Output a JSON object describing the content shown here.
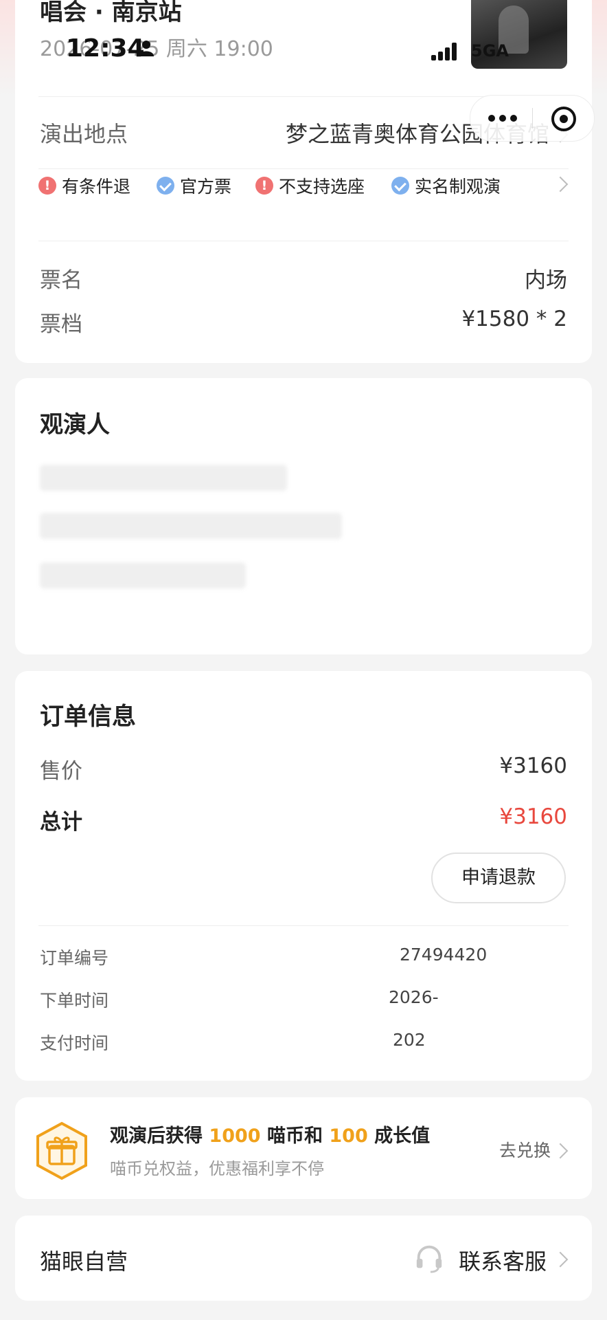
{
  "status_bar": {
    "time": "12:34",
    "network": "5GA"
  },
  "event": {
    "title_fragment": "唱会 · 南京站",
    "datetime": "2026-07-25 周六 19:00"
  },
  "venue": {
    "label": "演出地点",
    "value": "梦之蓝青奥体育公园体育馆"
  },
  "tags": [
    {
      "icon": "warning-icon",
      "label": "有条件退"
    },
    {
      "icon": "check-badge-icon",
      "label": "官方票"
    },
    {
      "icon": "warning-icon",
      "label": "不支持选座"
    },
    {
      "icon": "check-badge-icon",
      "label": "实名制观演"
    }
  ],
  "ticket": {
    "name_label": "票名",
    "name_value": "内场",
    "tier_label": "票档",
    "tier_value": "¥1580 * 2"
  },
  "attendee": {
    "title": "观演人"
  },
  "order": {
    "title": "订单信息",
    "price_label": "售价",
    "price_value": "¥3160",
    "total_label": "总计",
    "total_value": "¥3160",
    "refund_button": "申请退款",
    "order_no_label": "订单编号",
    "order_no_value": "27494420",
    "order_time_label": "下单时间",
    "order_time_value": "2026-",
    "pay_time_label": "支付时间",
    "pay_time_value": "202"
  },
  "reward": {
    "prefix": "观演后获得",
    "coins": "1000",
    "mid": "喵币和",
    "growth": "100",
    "suffix": "成长值",
    "subtitle": "喵币兑权益，优惠福利享不停",
    "action": "去兑换"
  },
  "service": {
    "label": "猫眼自营",
    "action": "联系客服"
  },
  "colors": {
    "accent_red": "#e8483e",
    "accent_orange": "#f0a11b",
    "info_blue": "#7eb0ee"
  }
}
